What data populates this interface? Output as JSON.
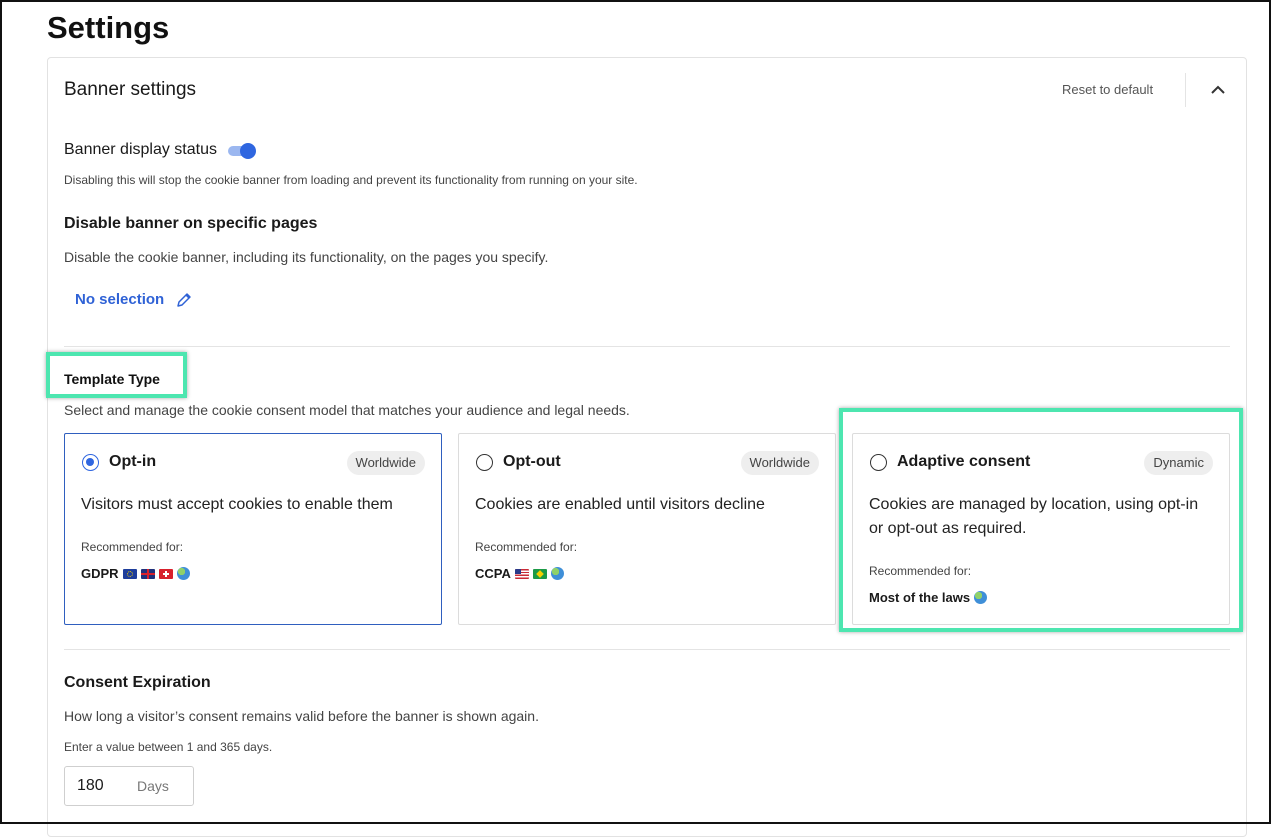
{
  "page": {
    "title": "Settings"
  },
  "banner": {
    "title": "Banner settings",
    "reset_label": "Reset to default",
    "display_status": {
      "label": "Banner display status",
      "enabled": true,
      "help": "Disabling this will stop the cookie banner from loading and prevent its functionality from running on your site."
    },
    "disable_pages": {
      "title": "Disable banner on specific pages",
      "description": "Disable the cookie banner, including its functionality, on the pages you specify.",
      "selection_label": "No selection"
    },
    "template_type": {
      "title": "Template Type",
      "description": "Select and manage the cookie consent model that matches your audience and legal needs.",
      "recommended_label": "Recommended for:",
      "options": [
        {
          "title": "Opt-in",
          "badge": "Worldwide",
          "description": "Visitors must accept cookies to enable them",
          "laws": "GDPR",
          "flags": [
            "eu-flag-icon",
            "uk-flag-icon",
            "switzerland-flag-icon",
            "globe-icon"
          ],
          "selected": true
        },
        {
          "title": "Opt-out",
          "badge": "Worldwide",
          "description": "Cookies are enabled until visitors decline",
          "laws": "CCPA",
          "flags": [
            "us-flag-icon",
            "brazil-flag-icon",
            "globe-icon"
          ],
          "selected": false
        },
        {
          "title": "Adaptive consent",
          "badge": "Dynamic",
          "description": "Cookies are managed by location, using opt-in or opt-out as required.",
          "laws": "Most of the laws",
          "flags": [
            "globe-icon"
          ],
          "selected": false
        }
      ]
    },
    "consent_expiration": {
      "title": "Consent Expiration",
      "description": "How long a visitor’s consent remains valid before the banner is shown again.",
      "hint": "Enter a value between 1 and 365 days.",
      "value": "180",
      "unit": "Days"
    }
  },
  "colors": {
    "accent": "#2f66e0",
    "link": "#2f62d6",
    "highlight": "#4de6b0",
    "selected_border": "#2f5fbf"
  }
}
